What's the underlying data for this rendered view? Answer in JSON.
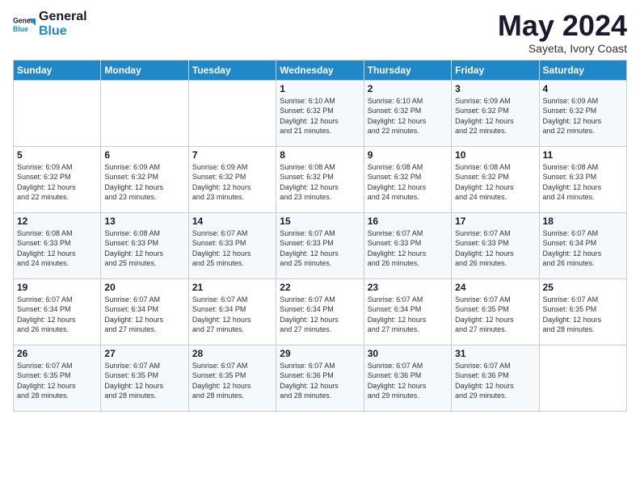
{
  "header": {
    "logo_line1": "General",
    "logo_line2": "Blue",
    "month_title": "May 2024",
    "subtitle": "Sayeta, Ivory Coast"
  },
  "weekdays": [
    "Sunday",
    "Monday",
    "Tuesday",
    "Wednesday",
    "Thursday",
    "Friday",
    "Saturday"
  ],
  "weeks": [
    [
      {
        "day": "",
        "info": ""
      },
      {
        "day": "",
        "info": ""
      },
      {
        "day": "",
        "info": ""
      },
      {
        "day": "1",
        "info": "Sunrise: 6:10 AM\nSunset: 6:32 PM\nDaylight: 12 hours\nand 21 minutes."
      },
      {
        "day": "2",
        "info": "Sunrise: 6:10 AM\nSunset: 6:32 PM\nDaylight: 12 hours\nand 22 minutes."
      },
      {
        "day": "3",
        "info": "Sunrise: 6:09 AM\nSunset: 6:32 PM\nDaylight: 12 hours\nand 22 minutes."
      },
      {
        "day": "4",
        "info": "Sunrise: 6:09 AM\nSunset: 6:32 PM\nDaylight: 12 hours\nand 22 minutes."
      }
    ],
    [
      {
        "day": "5",
        "info": "Sunrise: 6:09 AM\nSunset: 6:32 PM\nDaylight: 12 hours\nand 22 minutes."
      },
      {
        "day": "6",
        "info": "Sunrise: 6:09 AM\nSunset: 6:32 PM\nDaylight: 12 hours\nand 23 minutes."
      },
      {
        "day": "7",
        "info": "Sunrise: 6:09 AM\nSunset: 6:32 PM\nDaylight: 12 hours\nand 23 minutes."
      },
      {
        "day": "8",
        "info": "Sunrise: 6:08 AM\nSunset: 6:32 PM\nDaylight: 12 hours\nand 23 minutes."
      },
      {
        "day": "9",
        "info": "Sunrise: 6:08 AM\nSunset: 6:32 PM\nDaylight: 12 hours\nand 24 minutes."
      },
      {
        "day": "10",
        "info": "Sunrise: 6:08 AM\nSunset: 6:32 PM\nDaylight: 12 hours\nand 24 minutes."
      },
      {
        "day": "11",
        "info": "Sunrise: 6:08 AM\nSunset: 6:33 PM\nDaylight: 12 hours\nand 24 minutes."
      }
    ],
    [
      {
        "day": "12",
        "info": "Sunrise: 6:08 AM\nSunset: 6:33 PM\nDaylight: 12 hours\nand 24 minutes."
      },
      {
        "day": "13",
        "info": "Sunrise: 6:08 AM\nSunset: 6:33 PM\nDaylight: 12 hours\nand 25 minutes."
      },
      {
        "day": "14",
        "info": "Sunrise: 6:07 AM\nSunset: 6:33 PM\nDaylight: 12 hours\nand 25 minutes."
      },
      {
        "day": "15",
        "info": "Sunrise: 6:07 AM\nSunset: 6:33 PM\nDaylight: 12 hours\nand 25 minutes."
      },
      {
        "day": "16",
        "info": "Sunrise: 6:07 AM\nSunset: 6:33 PM\nDaylight: 12 hours\nand 26 minutes."
      },
      {
        "day": "17",
        "info": "Sunrise: 6:07 AM\nSunset: 6:33 PM\nDaylight: 12 hours\nand 26 minutes."
      },
      {
        "day": "18",
        "info": "Sunrise: 6:07 AM\nSunset: 6:34 PM\nDaylight: 12 hours\nand 26 minutes."
      }
    ],
    [
      {
        "day": "19",
        "info": "Sunrise: 6:07 AM\nSunset: 6:34 PM\nDaylight: 12 hours\nand 26 minutes."
      },
      {
        "day": "20",
        "info": "Sunrise: 6:07 AM\nSunset: 6:34 PM\nDaylight: 12 hours\nand 27 minutes."
      },
      {
        "day": "21",
        "info": "Sunrise: 6:07 AM\nSunset: 6:34 PM\nDaylight: 12 hours\nand 27 minutes."
      },
      {
        "day": "22",
        "info": "Sunrise: 6:07 AM\nSunset: 6:34 PM\nDaylight: 12 hours\nand 27 minutes."
      },
      {
        "day": "23",
        "info": "Sunrise: 6:07 AM\nSunset: 6:34 PM\nDaylight: 12 hours\nand 27 minutes."
      },
      {
        "day": "24",
        "info": "Sunrise: 6:07 AM\nSunset: 6:35 PM\nDaylight: 12 hours\nand 27 minutes."
      },
      {
        "day": "25",
        "info": "Sunrise: 6:07 AM\nSunset: 6:35 PM\nDaylight: 12 hours\nand 28 minutes."
      }
    ],
    [
      {
        "day": "26",
        "info": "Sunrise: 6:07 AM\nSunset: 6:35 PM\nDaylight: 12 hours\nand 28 minutes."
      },
      {
        "day": "27",
        "info": "Sunrise: 6:07 AM\nSunset: 6:35 PM\nDaylight: 12 hours\nand 28 minutes."
      },
      {
        "day": "28",
        "info": "Sunrise: 6:07 AM\nSunset: 6:35 PM\nDaylight: 12 hours\nand 28 minutes."
      },
      {
        "day": "29",
        "info": "Sunrise: 6:07 AM\nSunset: 6:36 PM\nDaylight: 12 hours\nand 28 minutes."
      },
      {
        "day": "30",
        "info": "Sunrise: 6:07 AM\nSunset: 6:36 PM\nDaylight: 12 hours\nand 29 minutes."
      },
      {
        "day": "31",
        "info": "Sunrise: 6:07 AM\nSunset: 6:36 PM\nDaylight: 12 hours\nand 29 minutes."
      },
      {
        "day": "",
        "info": ""
      }
    ]
  ]
}
